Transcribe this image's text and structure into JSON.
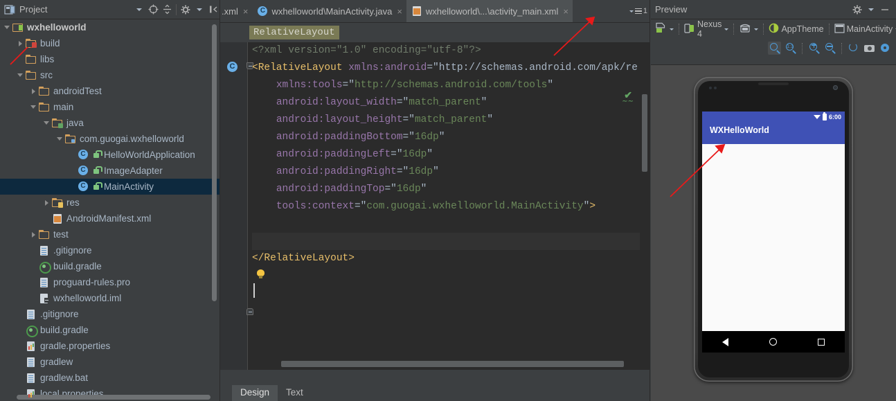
{
  "project_panel": {
    "title": "Project",
    "header_icons": [
      "project-view-icon",
      "chevron-down-icon",
      "target-icon",
      "collapse-icon",
      "gear-icon",
      "hide-icon"
    ],
    "tree": [
      {
        "label": "wxhelloworld",
        "depth": 0,
        "arrow": "open",
        "icon": "module",
        "bold": true,
        "selected": false
      },
      {
        "label": "build",
        "depth": 1,
        "arrow": "closed",
        "icon": "folder-red",
        "bold": false,
        "selected": false
      },
      {
        "label": "libs",
        "depth": 1,
        "arrow": "none",
        "icon": "folder",
        "bold": false,
        "selected": false
      },
      {
        "label": "src",
        "depth": 1,
        "arrow": "open",
        "icon": "folder",
        "bold": false,
        "selected": false
      },
      {
        "label": "androidTest",
        "depth": 2,
        "arrow": "closed",
        "icon": "folder",
        "bold": false,
        "selected": false
      },
      {
        "label": "main",
        "depth": 2,
        "arrow": "open",
        "icon": "folder",
        "bold": false,
        "selected": false
      },
      {
        "label": "java",
        "depth": 3,
        "arrow": "open",
        "icon": "folder-src",
        "bold": false,
        "selected": false
      },
      {
        "label": "com.guogai.wxhelloworld",
        "depth": 4,
        "arrow": "open",
        "icon": "package",
        "bold": false,
        "selected": false
      },
      {
        "label": "HelloWorldApplication",
        "depth": 5,
        "arrow": "none",
        "icon": "java-class",
        "bold": false,
        "selected": false
      },
      {
        "label": "ImageAdapter",
        "depth": 5,
        "arrow": "none",
        "icon": "java-class",
        "bold": false,
        "selected": false
      },
      {
        "label": "MainActivity",
        "depth": 5,
        "arrow": "none",
        "icon": "java-class",
        "bold": false,
        "selected": true
      },
      {
        "label": "res",
        "depth": 3,
        "arrow": "closed",
        "icon": "folder-res",
        "bold": false,
        "selected": false
      },
      {
        "label": "AndroidManifest.xml",
        "depth": 3,
        "arrow": "none",
        "icon": "xml-file",
        "bold": false,
        "selected": false
      },
      {
        "label": "test",
        "depth": 2,
        "arrow": "closed",
        "icon": "folder",
        "bold": false,
        "selected": false
      },
      {
        "label": ".gitignore",
        "depth": 2,
        "arrow": "none",
        "icon": "file",
        "bold": false,
        "selected": false
      },
      {
        "label": "build.gradle",
        "depth": 2,
        "arrow": "none",
        "icon": "gradle",
        "bold": false,
        "selected": false
      },
      {
        "label": "proguard-rules.pro",
        "depth": 2,
        "arrow": "none",
        "icon": "file",
        "bold": false,
        "selected": false
      },
      {
        "label": "wxhelloworld.iml",
        "depth": 2,
        "arrow": "none",
        "icon": "iml",
        "bold": false,
        "selected": false
      },
      {
        "label": ".gitignore",
        "depth": 1,
        "arrow": "none",
        "icon": "file",
        "bold": false,
        "selected": false
      },
      {
        "label": "build.gradle",
        "depth": 1,
        "arrow": "none",
        "icon": "gradle",
        "bold": false,
        "selected": false
      },
      {
        "label": "gradle.properties",
        "depth": 1,
        "arrow": "none",
        "icon": "properties",
        "bold": false,
        "selected": false
      },
      {
        "label": "gradlew",
        "depth": 1,
        "arrow": "none",
        "icon": "file",
        "bold": false,
        "selected": false
      },
      {
        "label": "gradlew.bat",
        "depth": 1,
        "arrow": "none",
        "icon": "file",
        "bold": false,
        "selected": false
      },
      {
        "label": "local.properties",
        "depth": 1,
        "arrow": "none",
        "icon": "properties",
        "bold": false,
        "selected": false
      }
    ]
  },
  "editor": {
    "tabs": [
      {
        "label": ".xml",
        "icon": "xml-file",
        "active": false,
        "truncated": true
      },
      {
        "label": "wxhelloworld\\MainActivity.java",
        "icon": "java-class",
        "active": false,
        "truncated": false
      },
      {
        "label": "wxhelloworld\\...\\activity_main.xml",
        "icon": "xml-file",
        "active": true,
        "truncated": false
      }
    ],
    "tab_close_glyph": "×",
    "open_tabs_count": "1",
    "breadcrumb": "RelativeLayout",
    "code_lines": [
      {
        "line": "<?xml version=\"1.0\" encoding=\"utf-8\"?>",
        "current": false
      },
      {
        "line": "<RelativeLayout xmlns:android=\"http://schemas.android.com/apk/re",
        "current": false
      },
      {
        "line": "    xmlns:tools=\"http://schemas.android.com/tools\"",
        "current": false
      },
      {
        "line": "    android:layout_width=\"match_parent\"",
        "current": false
      },
      {
        "line": "    android:layout_height=\"match_parent\"",
        "current": false
      },
      {
        "line": "    android:paddingBottom=\"16dp\"",
        "current": false
      },
      {
        "line": "    android:paddingLeft=\"16dp\"",
        "current": false
      },
      {
        "line": "    android:paddingRight=\"16dp\"",
        "current": false
      },
      {
        "line": "    android:paddingTop=\"16dp\"",
        "current": false
      },
      {
        "line": "    tools:context=\"com.guogai.wxhelloworld.MainActivity\">",
        "current": false
      },
      {
        "line": "",
        "current": false
      },
      {
        "line": "",
        "current": true
      },
      {
        "line": "</RelativeLayout>",
        "current": false
      }
    ],
    "inspection_status": "ok-checkmark",
    "bottom_tabs": [
      {
        "label": "Design",
        "active": true
      },
      {
        "label": "Text",
        "active": false
      }
    ]
  },
  "preview": {
    "title": "Preview",
    "toolbar": {
      "config_label": "",
      "device_label": "Nexus 4",
      "orientation_label": "",
      "theme_label": "AppTheme",
      "activity_label": "MainActivity",
      "zoom_buttons": [
        "zoom-fit-icon",
        "zoom-actual-icon",
        "zoom-in-icon",
        "zoom-out-icon",
        "refresh-icon",
        "screenshot-icon",
        "settings-icon"
      ]
    },
    "device": {
      "status_time": "6:00",
      "status_icons": [
        "wifi-icon",
        "battery-icon"
      ],
      "app_title": "WXHelloWorld",
      "nav_buttons": [
        "back-icon",
        "home-icon",
        "recents-icon"
      ],
      "app_bar_color": "#3f51b5",
      "body_color": "#fafafa"
    }
  },
  "annotations": {
    "arrow_color": "#e81a1a",
    "arrows": [
      {
        "name": "arrow-to-build-folder"
      },
      {
        "name": "arrow-to-active-tab"
      },
      {
        "name": "arrow-to-preview-body"
      }
    ]
  }
}
